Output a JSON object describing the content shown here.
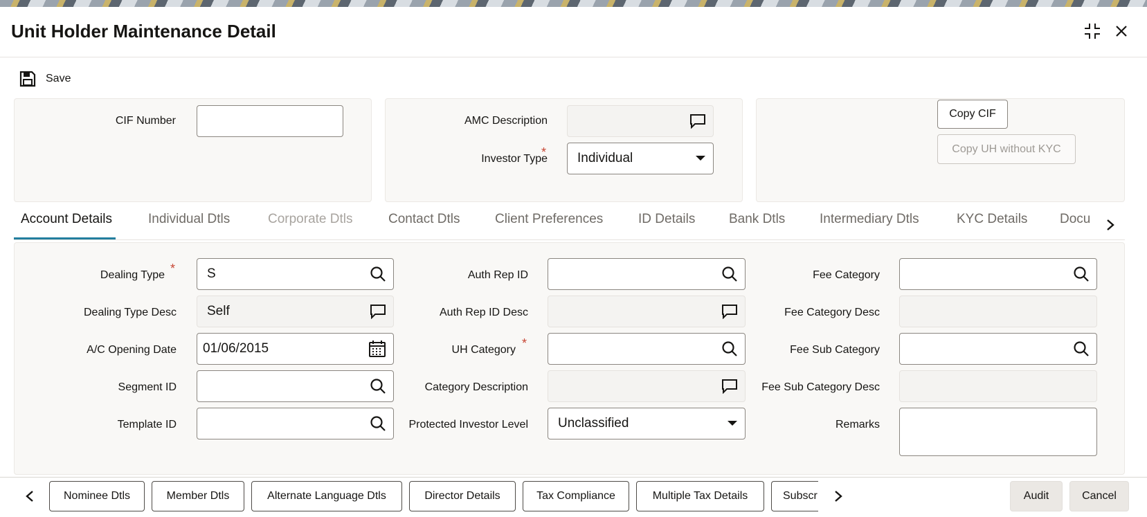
{
  "window": {
    "title": "Unit Holder Maintenance Detail"
  },
  "toolbar": {
    "save_label": "Save"
  },
  "header": {
    "cif_label": "CIF Number",
    "cif_value": "",
    "amc_desc_label": "AMC Description",
    "amc_desc_value": "",
    "investor_type_label": "Investor Type",
    "investor_type_value": "Individual",
    "copy_cif_label": "Copy CIF",
    "copy_uh_label": "Copy UH without KYC"
  },
  "tabs": [
    {
      "label": "Account Details",
      "state": "active"
    },
    {
      "label": "Individual Dtls",
      "state": "normal"
    },
    {
      "label": "Corporate Dtls",
      "state": "disabled"
    },
    {
      "label": "Contact Dtls",
      "state": "normal"
    },
    {
      "label": "Client Preferences",
      "state": "normal"
    },
    {
      "label": "ID Details",
      "state": "normal"
    },
    {
      "label": "Bank Dtls",
      "state": "normal"
    },
    {
      "label": "Intermediary Dtls",
      "state": "normal"
    },
    {
      "label": "KYC Details",
      "state": "normal"
    },
    {
      "label": "Docu",
      "state": "normal"
    }
  ],
  "account": {
    "dealing_type_label": "Dealing Type",
    "dealing_type_value": "S",
    "dealing_type_desc_label": "Dealing Type Desc",
    "dealing_type_desc_value": "Self",
    "ac_opening_date_label": "A/C Opening Date",
    "ac_opening_date_value": "01/06/2015",
    "segment_id_label": "Segment ID",
    "segment_id_value": "",
    "template_id_label": "Template ID",
    "template_id_value": "",
    "auth_rep_id_label": "Auth Rep ID",
    "auth_rep_id_value": "",
    "auth_rep_id_desc_label": "Auth Rep ID Desc",
    "auth_rep_id_desc_value": "",
    "uh_category_label": "UH Category",
    "uh_category_value": "",
    "category_desc_label": "Category Description",
    "category_desc_value": "",
    "protected_investor_label": "Protected Investor Level",
    "protected_investor_value": "Unclassified",
    "fee_category_label": "Fee Category",
    "fee_category_value": "",
    "fee_category_desc_label": "Fee Category Desc",
    "fee_category_desc_value": "",
    "fee_sub_category_label": "Fee Sub Category",
    "fee_sub_category_value": "",
    "fee_sub_category_desc_label": "Fee Sub Category Desc",
    "fee_sub_category_desc_value": "",
    "remarks_label": "Remarks",
    "remarks_value": ""
  },
  "required_marker": "*",
  "bottom": {
    "buttons": [
      "Nominee Dtls",
      "Member Dtls",
      "Alternate Language Dtls",
      "Director Details",
      "Tax Compliance",
      "Multiple Tax Details",
      "Subscr"
    ],
    "audit_label": "Audit",
    "cancel_label": "Cancel"
  },
  "colors": {
    "accent": "#227e9e",
    "required": "#c74634"
  }
}
